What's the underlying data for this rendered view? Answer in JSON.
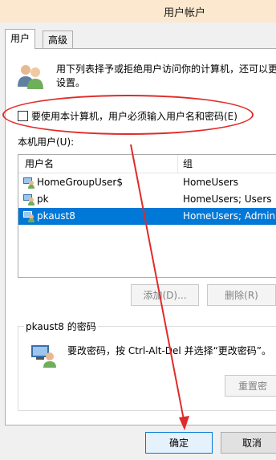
{
  "window": {
    "title": "用户帐户"
  },
  "tabs": [
    {
      "label": "用户"
    },
    {
      "label": "高级"
    }
  ],
  "description": "用下列表择予或拒绝用户访问你的计算机，还可以更\n设置。",
  "require_login": {
    "label": "要使用本计算机，用户必须输入用户名和密码(E)",
    "checked": false
  },
  "local_users": {
    "label": "本机用户(U):",
    "columns": [
      "用户名",
      "组"
    ],
    "rows": [
      {
        "name": "HomeGroupUser$",
        "group": "HomeUsers"
      },
      {
        "name": "pk",
        "group": "HomeUsers; Users"
      },
      {
        "name": "pkaust8",
        "group": "HomeUsers; Admini"
      }
    ],
    "selected_index": 2
  },
  "buttons": {
    "add": "添加(D)...",
    "remove": "删除(R)",
    "reset": "重置密",
    "ok": "确定",
    "cancel": "取消"
  },
  "password_group": {
    "title": "pkaust8 的密码",
    "text": "要改密码，按 Ctrl-Alt-Del 并选择“更改密码”。"
  },
  "colors": {
    "annotation": "#e12a2a",
    "selection": "#0078d7"
  }
}
